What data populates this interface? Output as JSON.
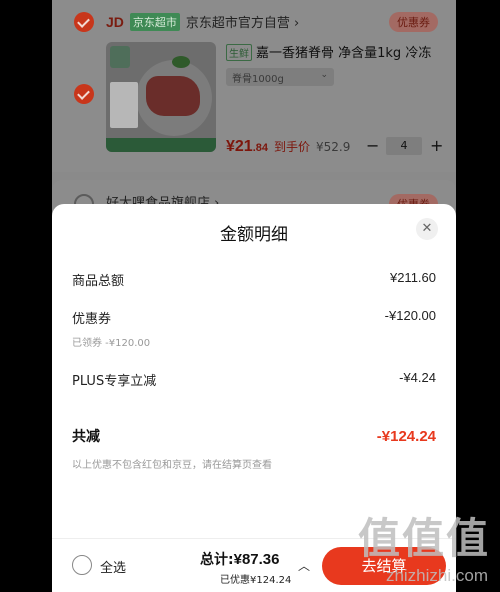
{
  "cart": {
    "store1": {
      "brand": "JD",
      "chip": "京东超市",
      "name": "京东超市官方自营 ›",
      "coupon": "优惠券"
    },
    "product": {
      "tag": "生鲜",
      "title": "嘉一香猪脊骨 净含量1kg 冷冻",
      "spec": "脊骨1000g",
      "price_int": "¥21",
      "price_dec": ".84",
      "price_tag": "到手价",
      "orig_price": "¥52.9",
      "qty": "4",
      "minus": "−",
      "plus": "+"
    },
    "store2": {
      "name": "好大嘿食品旗舰店 ›",
      "coupon": "优惠券"
    }
  },
  "modal": {
    "title": "金额明细",
    "close": "✕",
    "rows": [
      {
        "label": "商品总额",
        "value": "¥211.60"
      },
      {
        "label": "优惠券",
        "value": "-¥120.00",
        "sub": "已领券 -¥120.00"
      },
      {
        "label": "PLUS专享立减",
        "value": "-¥4.24"
      }
    ],
    "total": {
      "label": "共减",
      "value": "-¥124.24"
    },
    "note": "以上优惠不包含红包和京豆，请在结算页查看"
  },
  "bottom": {
    "select_all": "全选",
    "total_prefix": "总计:",
    "total_amount": "¥87.36",
    "saved": "已优惠¥124.24",
    "toggle": "︿",
    "checkout": "去结算"
  },
  "watermark": {
    "main": "值值值",
    "site": "zhizhizhi.com"
  }
}
